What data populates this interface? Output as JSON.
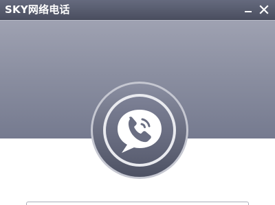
{
  "window": {
    "title": "SKY网络电话",
    "controls": {
      "minimize_icon": "minimize-icon",
      "close_icon": "close-icon"
    }
  },
  "logo": {
    "icon": "phone-chat-bubble-icon"
  },
  "colors": {
    "titlebar": "#575b6d",
    "header_top": "#9fa2b2",
    "header_bottom": "#757a8f",
    "logo_ring": "#5b5f72",
    "logo_inner": "#6a6e82",
    "body": "#ffffff"
  }
}
